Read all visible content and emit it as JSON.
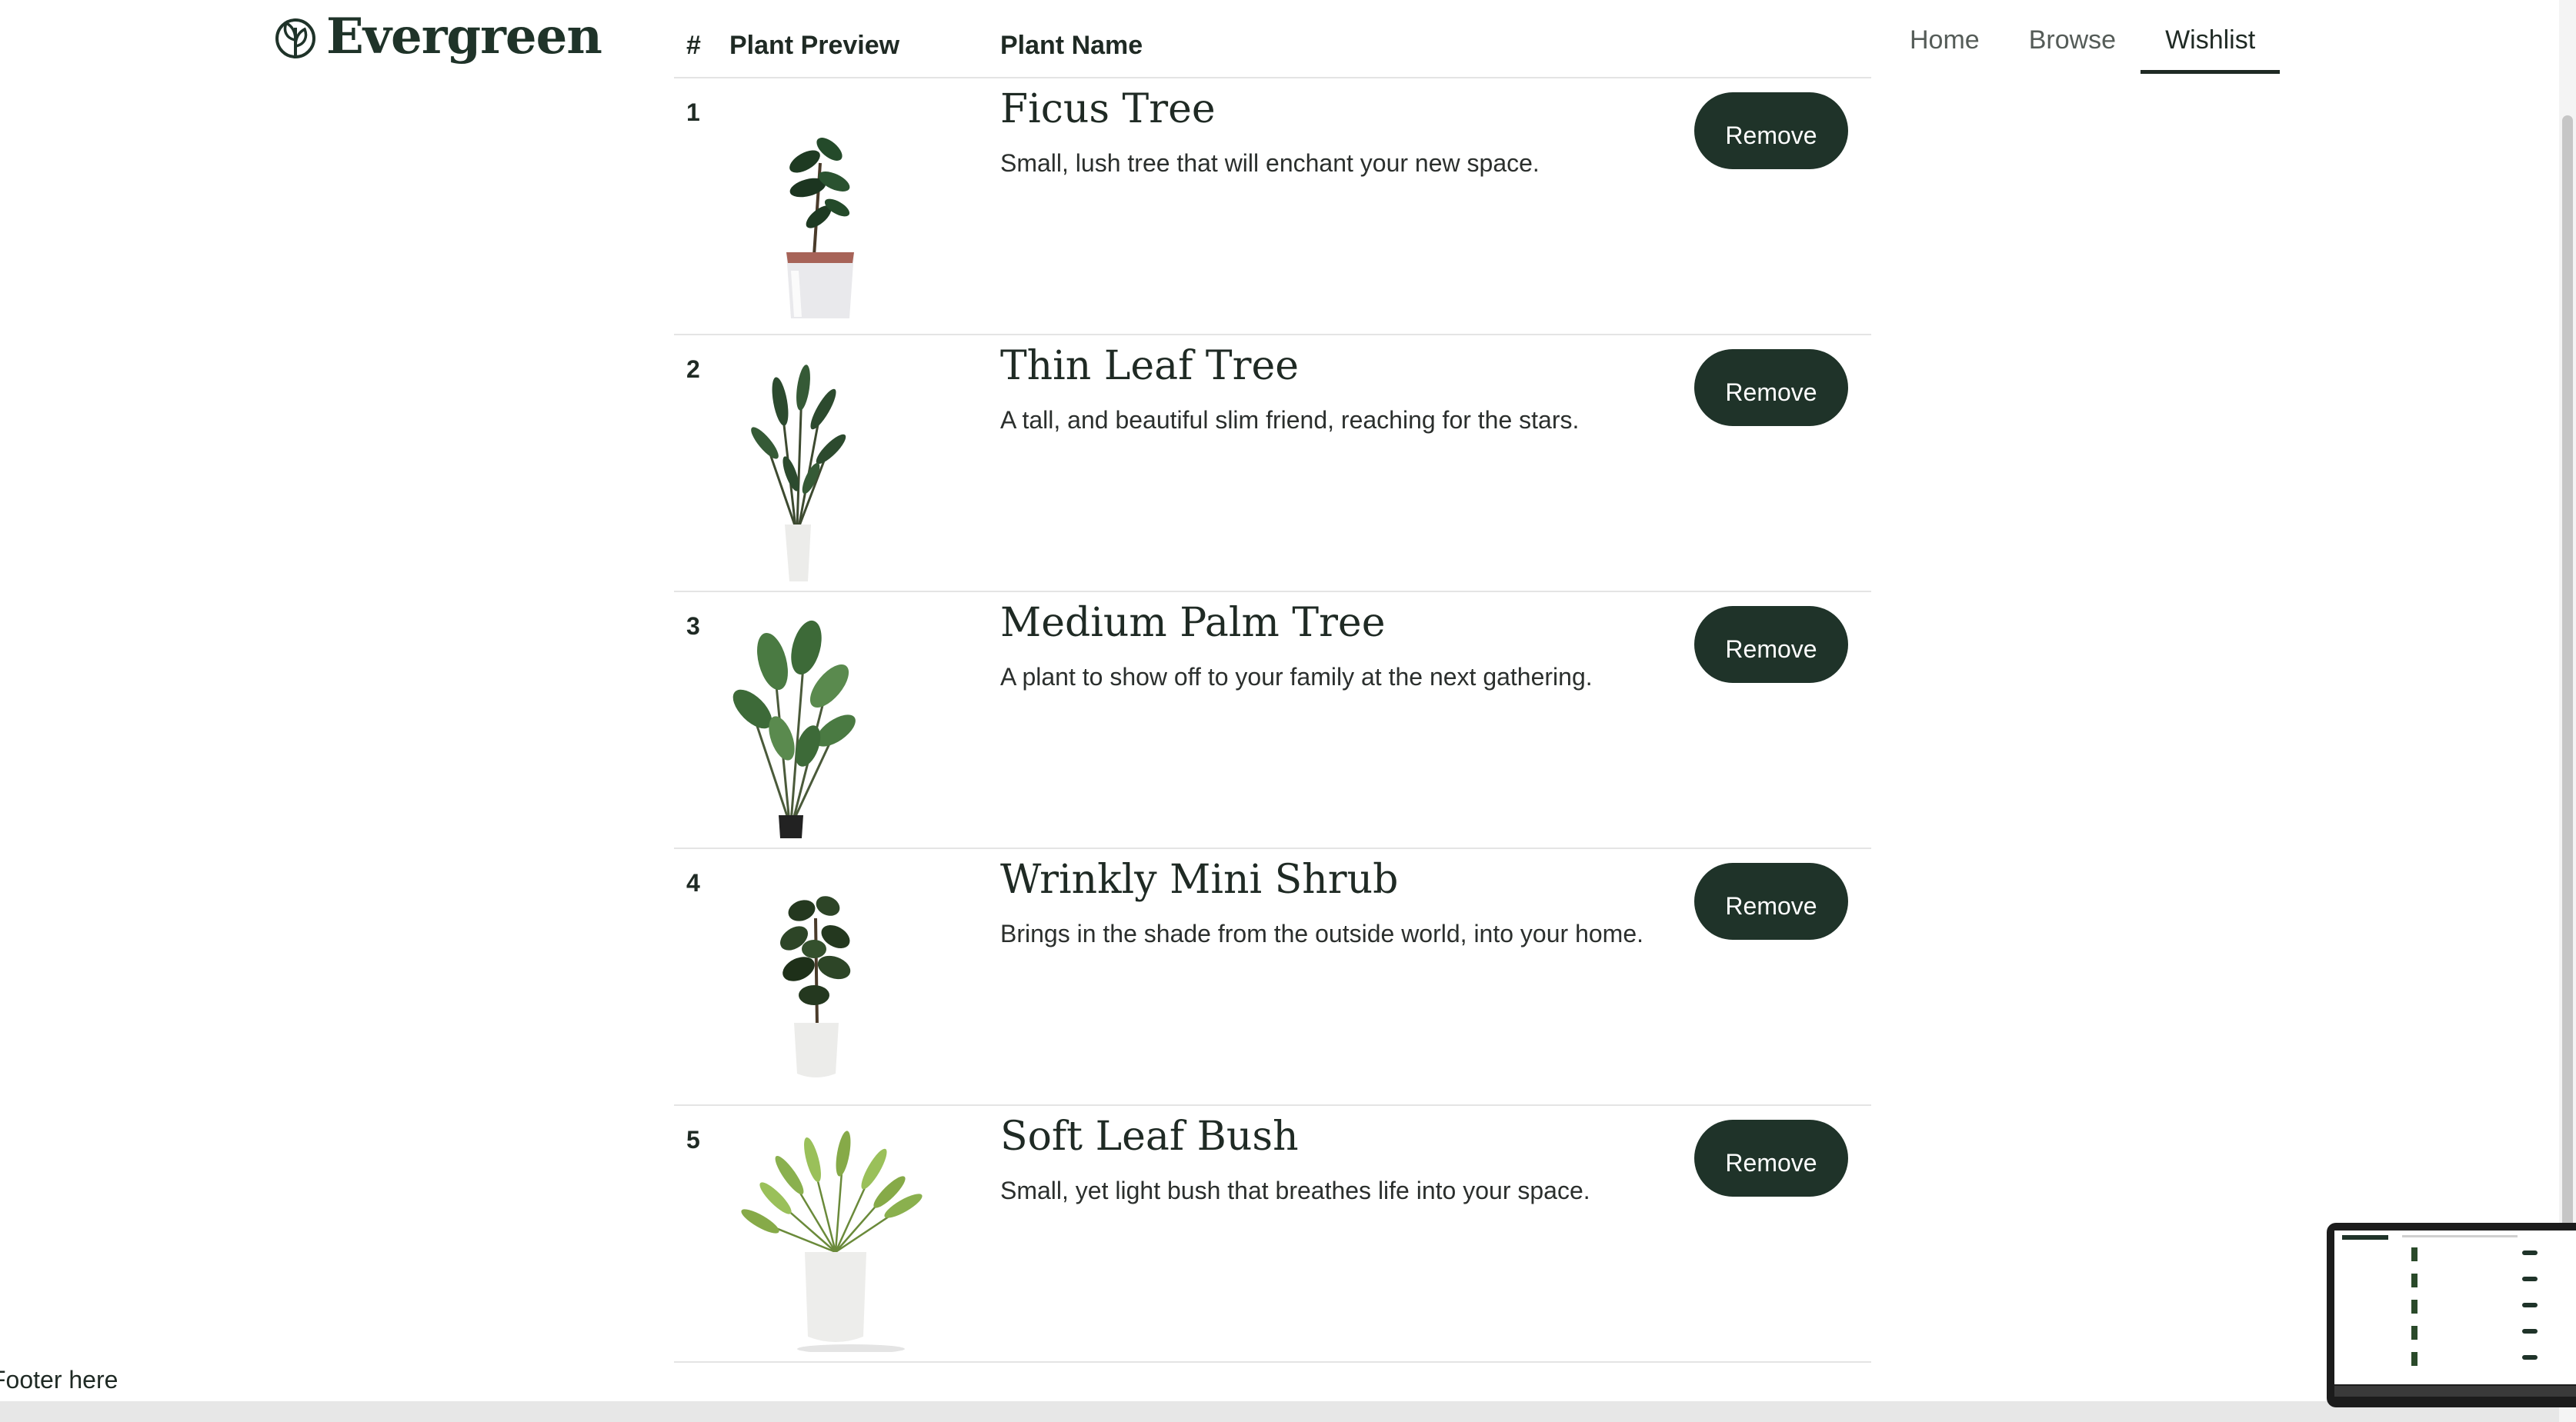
{
  "brand": {
    "name": "Evergreen",
    "icon": "leaf-logo-icon"
  },
  "nav": [
    {
      "label": "Home",
      "active": false
    },
    {
      "label": "Browse",
      "active": false
    },
    {
      "label": "Wishlist",
      "active": true
    }
  ],
  "table": {
    "headers": {
      "num": "#",
      "preview": "Plant Preview",
      "name": "Plant Name"
    },
    "rows": [
      {
        "num": "1",
        "name": "Ficus Tree",
        "desc": "Small, lush tree that will enchant your new space.",
        "action": "Remove"
      },
      {
        "num": "2",
        "name": "Thin Leaf Tree",
        "desc": "A tall, and beautiful slim friend, reaching for the stars.",
        "action": "Remove"
      },
      {
        "num": "3",
        "name": "Medium Palm Tree",
        "desc": "A plant to show off to your family at the next gathering.",
        "action": "Remove"
      },
      {
        "num": "4",
        "name": "Wrinkly Mini Shrub",
        "desc": "Brings in the shade from the outside world, into your home.",
        "action": "Remove"
      },
      {
        "num": "5",
        "name": "Soft Leaf Bush",
        "desc": "Small, yet light bush that breathes life into your space.",
        "action": "Remove"
      }
    ]
  },
  "footer": {
    "text": "Footer here"
  },
  "colors": {
    "brand": "#1f3329",
    "button": "#1f3329",
    "divider": "#e4e4e4"
  }
}
